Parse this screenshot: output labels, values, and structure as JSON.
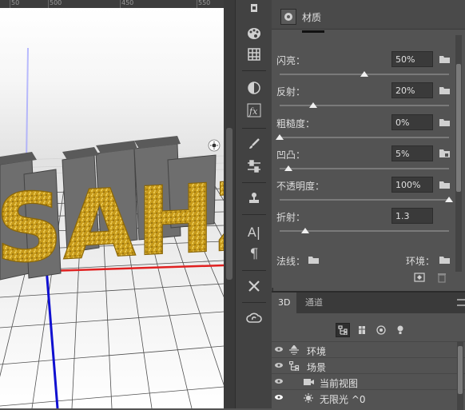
{
  "ruler": {
    "labels": [
      "50",
      "500",
      "450",
      "550"
    ]
  },
  "canvas": {
    "scene_text": "SAHZ"
  },
  "toolbar": {
    "tools": [
      "3d-view-icon",
      "palette-icon",
      "grid-icon",
      "adjustment-icon",
      "fx-icon",
      "brush-icon",
      "adjust-sliders-icon",
      "clone-stamp-icon",
      "character-icon",
      "paragraph-icon",
      "tools-icon",
      "creative-cloud-icon"
    ],
    "character_glyph": "A|",
    "paragraph_glyph": "¶",
    "fx_glyph": "fx"
  },
  "properties": {
    "section_label": "材质",
    "rows": [
      {
        "label": "闪亮：",
        "value": "50%",
        "level": 0.5
      },
      {
        "label": "反射：",
        "value": "20%",
        "level": 0.2
      },
      {
        "label": "粗糙度：",
        "value": "0%",
        "level": 0.0
      },
      {
        "label": "凹凸：",
        "value": "5%",
        "level": 0.05
      },
      {
        "label": "不透明度：",
        "value": "100%",
        "level": 1.0
      },
      {
        "label": "折射：",
        "value": "1.3",
        "level": 0.15
      }
    ],
    "normal_label": "法线：",
    "environment_label": "环境："
  },
  "panel3d": {
    "tabs": [
      "3D",
      "通道"
    ],
    "filters": [
      "scene-filter-icon",
      "mesh-filter-icon",
      "material-filter-icon",
      "light-filter-icon"
    ],
    "layers": [
      {
        "name": "环境",
        "icon": "environment-icon",
        "visible": true
      },
      {
        "name": "场景",
        "icon": "scene-icon",
        "visible": true
      },
      {
        "name": "当前视图",
        "icon": "camera-icon",
        "visible": true
      },
      {
        "name": "无限光 ^0",
        "icon": "light-icon",
        "visible": true
      }
    ]
  },
  "colors": {
    "accent": "#3d7bf0",
    "x_axis": "#e02020",
    "y_axis": "#1010d0",
    "gold": "#d4a820"
  }
}
